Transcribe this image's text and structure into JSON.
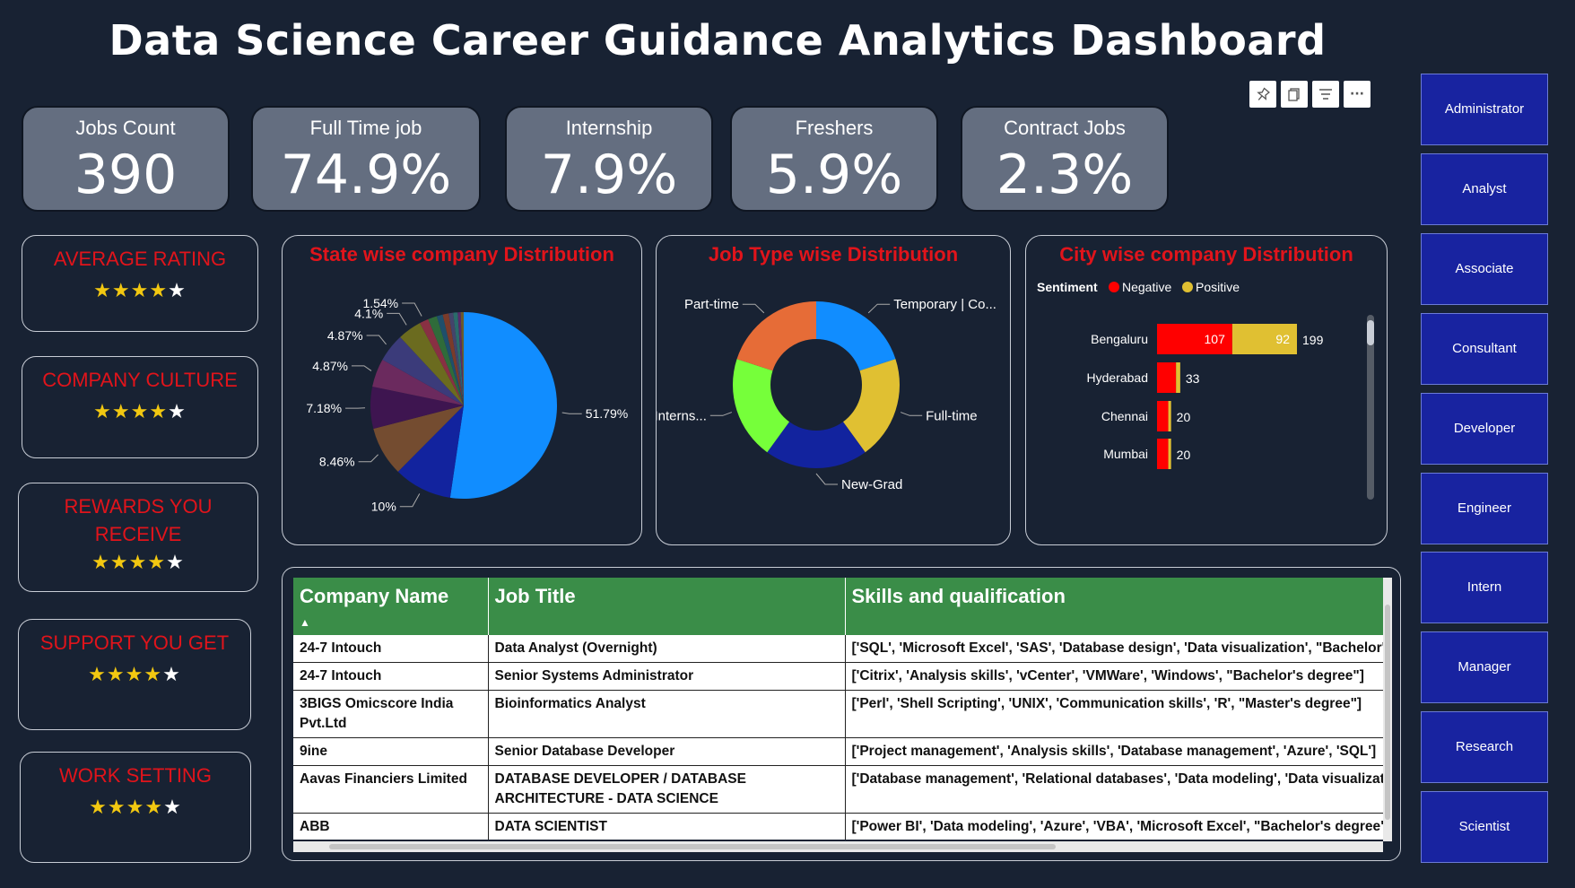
{
  "title": "Data Science Career Guidance Analytics Dashboard",
  "kpis": [
    {
      "label": "Jobs Count",
      "value": "390"
    },
    {
      "label": "Full Time job",
      "value": "74.9%"
    },
    {
      "label": "Internship",
      "value": "7.9%"
    },
    {
      "label": "Freshers",
      "value": "5.9%"
    },
    {
      "label": "Contract Jobs",
      "value": "2.3%"
    }
  ],
  "ratings": [
    {
      "label": "AVERAGE RATING",
      "stars": 4,
      "max": 5
    },
    {
      "label": "COMPANY CULTURE",
      "stars": 4,
      "max": 5
    },
    {
      "label": "REWARDS YOU RECEIVE",
      "stars": 4,
      "max": 5
    },
    {
      "label": "SUPPORT YOU GET",
      "stars": 4,
      "max": 5
    },
    {
      "label": "WORK SETTING",
      "stars": 4,
      "max": 5
    }
  ],
  "toolbar": {
    "icons": [
      "pin-icon",
      "copy-icon",
      "filter-icon",
      "more-icon"
    ],
    "more_label": "···"
  },
  "roles": [
    "Administrator",
    "Analyst",
    "Associate",
    "Consultant",
    "Developer",
    "Engineer",
    "Intern",
    "Manager",
    "Research",
    "Scientist"
  ],
  "state_chart": {
    "title": "State wise company Distribution",
    "chart_data": {
      "type": "pie",
      "labels": [
        "51.79%",
        "10%",
        "8.46%",
        "7.18%",
        "4.87%",
        "4.87%",
        "4.1%",
        "1.54%"
      ],
      "values": [
        51.79,
        10,
        8.46,
        7.18,
        4.87,
        4.87,
        4.1,
        1.54,
        1.54,
        1.03,
        1.03,
        0.77,
        0.77,
        0.51,
        0.51
      ],
      "colors": [
        "#118dff",
        "#12239e",
        "#744c30",
        "#3e1550",
        "#6b2a5e",
        "#3b3b7a",
        "#6b6b1f",
        "#883043",
        "#2f6b3a",
        "#1f4f6b",
        "#7a3b2a",
        "#44446b",
        "#2a6b6b",
        "#5a2a6b",
        "#6b5a2a"
      ]
    }
  },
  "jobtype_chart": {
    "title": "Job Type wise Distribution",
    "chart_data": {
      "type": "pie",
      "categories": [
        "Temporary | Co...",
        "Full-time",
        "New-Grad",
        "Interns...",
        "Part-time"
      ],
      "values": [
        20,
        20,
        20,
        20,
        20
      ],
      "colors": [
        "#118dff",
        "#e0c032",
        "#12239e",
        "#76ff3a",
        "#e66c37"
      ]
    }
  },
  "city_chart": {
    "title": "City wise company Distribution",
    "legend_title": "Sentiment",
    "legend": [
      {
        "name": "Negative",
        "color": "#ff0000"
      },
      {
        "name": "Positive",
        "color": "#e0c032"
      }
    ],
    "chart_data": {
      "type": "bar",
      "orientation": "horizontal",
      "stacked": true,
      "categories": [
        "Bengaluru",
        "Hyderabad",
        "Chennai",
        "Mumbai"
      ],
      "series": [
        {
          "name": "Negative",
          "values": [
            107,
            27,
            16,
            16
          ]
        },
        {
          "name": "Positive",
          "values": [
            92,
            6,
            4,
            4
          ]
        }
      ],
      "totals": [
        199,
        33,
        20,
        20
      ],
      "segment_labels": [
        "107",
        "92"
      ],
      "total_labels": [
        "199",
        "33",
        "20",
        "20"
      ]
    }
  },
  "table": {
    "headers": [
      "Company Name",
      "Job Title",
      "Skills and qualification"
    ],
    "rows": [
      [
        "24-7 Intouch",
        "Data Analyst (Overnight)",
        "['SQL', 'Microsoft Excel', 'SAS', 'Database design', 'Data visualization', \"Bachelor's degree\"]"
      ],
      [
        "24-7 Intouch",
        "Senior Systems Administrator",
        "['Citrix', 'Analysis skills', 'vCenter', 'VMWare', 'Windows', \"Bachelor's degree\"]"
      ],
      [
        "3BIGS Omicscore India Pvt.Ltd",
        "Bioinformatics Analyst",
        "['Perl', 'Shell Scripting', 'UNIX', 'Communication skills', 'R', \"Master's degree\"]"
      ],
      [
        "9ine",
        "Senior Database Developer",
        "['Project management', 'Analysis skills', 'Database management', 'Azure', 'SQL']"
      ],
      [
        "Aavas Financiers Limited",
        "DATABASE DEVELOPER / DATABASE ARCHITECTURE - DATA SCIENCE",
        "['Database management', 'Relational databases', 'Data modeling', 'Data visualization']"
      ],
      [
        "ABB",
        "DATA SCIENTIST",
        "['Power BI', 'Data modeling', 'Azure', 'VBA', 'Microsoft Excel', \"Bachelor's degree\"]"
      ]
    ]
  }
}
